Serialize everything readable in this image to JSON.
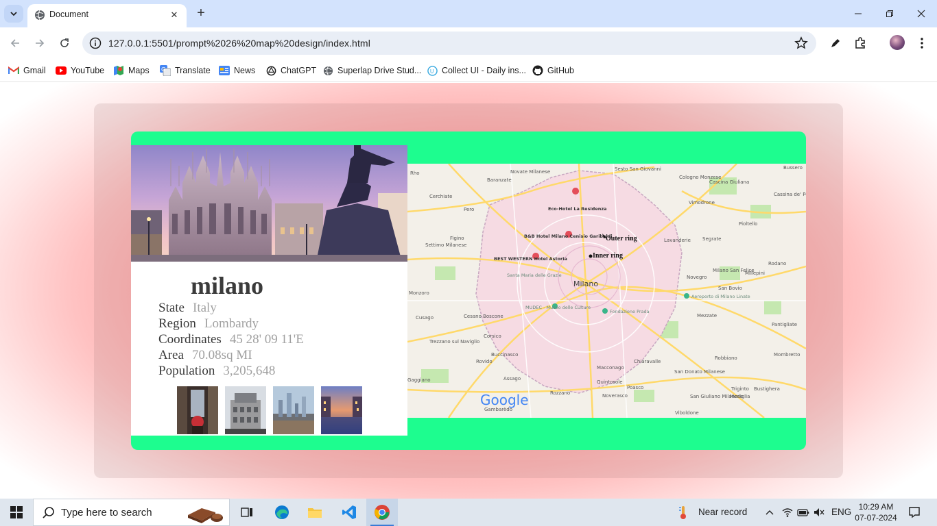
{
  "browser": {
    "tab_title": "Document",
    "url": "127.0.0.1:5501/prompt%2026%20map%20design/index.html",
    "bookmarks": [
      {
        "label": "Gmail",
        "icon": "gmail-icon"
      },
      {
        "label": "YouTube",
        "icon": "youtube-icon"
      },
      {
        "label": "Maps",
        "icon": "maps-icon"
      },
      {
        "label": "Translate",
        "icon": "translate-icon"
      },
      {
        "label": "News",
        "icon": "news-icon"
      },
      {
        "label": "ChatGPT",
        "icon": "chatgpt-icon"
      },
      {
        "label": "Superlap Drive Stud...",
        "icon": "globe-icon"
      },
      {
        "label": "Collect UI - Daily ins...",
        "icon": "collectui-icon"
      },
      {
        "label": "GitHub",
        "icon": "github-icon"
      }
    ]
  },
  "city": {
    "name": "milano",
    "rows": [
      {
        "key": "State",
        "value": "Italy"
      },
      {
        "key": "Region",
        "value": "Lombardy"
      },
      {
        "key": "Coordinates",
        "value": "45 28' 09 11'E"
      },
      {
        "key": "Area",
        "value": "70.08sq MI"
      },
      {
        "key": "Population",
        "value": "3,205,648"
      }
    ]
  },
  "map": {
    "labels": {
      "center": "Milano",
      "outer": "Outer ring",
      "inner": "Inner ring",
      "google": "Google",
      "towns": [
        "Rho",
        "Novate Milanese",
        "Sesto San Giovanni",
        "Cologno Monzese",
        "Cascina Giuliana",
        "Bussero",
        "Cerchiate",
        "Pero",
        "Vimodrone",
        "Cassina de' Pecchi",
        "Figino",
        "Settimo Milanese",
        "Segrate",
        "Pioltello",
        "Lavanderie",
        "Novegro",
        "Rodano",
        "Milano San Felice",
        "Millepini",
        "San Bovio",
        "Segrate",
        "Corsico",
        "Cesano Boscone",
        "Cusago",
        "Buccinasco",
        "Rovido",
        "Assago",
        "Trezzano sul Naviglio",
        "Gaggiano",
        "Rozzano",
        "Gambarèdo",
        "Quintosole",
        "Macconago",
        "Chiaravalle",
        "Poasco",
        "Noverasco",
        "Mezzate",
        "Robbiano",
        "Pantigliate",
        "Mombretto",
        "Triginto",
        "Mediglia",
        "Bustighera",
        "San Donato Milanese",
        "San Giuliano Milanese",
        "Viboldone",
        "Baranzate",
        "Monzoro",
        "Zeloforamagno"
      ],
      "pois": [
        "Eco-Hotel La Residenza",
        "B&B Hotel Milano Cenisio Garibaldi",
        "BEST WESTERN Hotel Astoria",
        "Santa Maria delle Grazie",
        "MUDEC - Museo delle Culture",
        "Fondazione Prada",
        "Aeroporto di Milano Linate"
      ]
    }
  },
  "taskbar": {
    "search_placeholder": "Type here to search",
    "weather": "Near record",
    "language": "ENG",
    "time": "10:29 AM",
    "date": "07-07-2024"
  },
  "colors": {
    "card_green": "#1dfd8f",
    "background_glow": "#ff8a8a",
    "omnibox": "#e9eef6",
    "tabbar": "#d3e3fd"
  }
}
